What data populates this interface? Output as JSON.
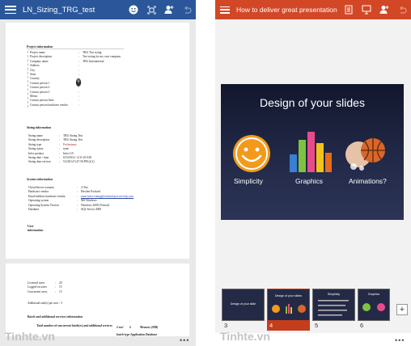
{
  "word": {
    "title": "LN_Sizing_TRG_test",
    "header_icons": [
      "smiley-icon",
      "scan-icon",
      "add-person-icon",
      "undo-icon"
    ],
    "project_info": {
      "section": "Project information",
      "rows": [
        {
          "k": "Project name",
          "v": "TRG Test sizing"
        },
        {
          "k": "Project description",
          "v": "Test sizing for my own company"
        },
        {
          "k": "Company name",
          "v": "TRG International"
        },
        {
          "k": "Address",
          "v": ""
        },
        {
          "k": "City",
          "v": ""
        },
        {
          "k": "State",
          "v": ""
        },
        {
          "k": "Country",
          "v": ""
        },
        {
          "k": "Contact person 1",
          "v": ""
        },
        {
          "k": "Contact person 2",
          "v": ""
        },
        {
          "k": "Contact person 3",
          "v": ""
        },
        {
          "k": "Memo",
          "v": ""
        },
        {
          "k": "Contact person Infor",
          "v": ""
        },
        {
          "k": "Contact person hardware vendor",
          "v": ""
        }
      ]
    },
    "sizing_info": {
      "section": "Sizing information",
      "rows": [
        {
          "k": "Sizing name",
          "v": "TRG Sizing Test"
        },
        {
          "k": "Sizing description",
          "v": "TRG Sizing Test"
        },
        {
          "k": "Sizing type",
          "v": "Preliminary"
        },
        {
          "k": "Sizing status",
          "v": "none"
        },
        {
          "k": "Infor product",
          "v": "Infor LN"
        },
        {
          "k": "Sizing date / time",
          "v": "6/10/2014 / 4:31:25 AM"
        },
        {
          "k": "Sizing data version",
          "v": "5/2/2014 5:47:56 PM (# 2)"
        }
      ]
    },
    "system_info": {
      "section": "System information",
      "rows": [
        {
          "k": "Client/Server scenario",
          "v": "2-Tier"
        },
        {
          "k": "Hardware vendor",
          "v": "Hewlett Packard"
        },
        {
          "k": "Email-address hardware vendor",
          "v": "team-infor-sizing@external.procurve.hp.com"
        },
        {
          "k": "Operating system",
          "v": "MS Windows"
        },
        {
          "k": "Operating System Version",
          "v": "Windows 2008 (Virtual)"
        },
        {
          "k": "Database",
          "v": "SQL Server 2008"
        }
      ]
    },
    "user_info": {
      "section_line1": "User",
      "section_line2": "information"
    },
    "page2": {
      "rows": [
        {
          "k": "Licensed users",
          "v": "20"
        },
        {
          "k": "Logged-on users",
          "v": "15"
        },
        {
          "k": "Concurrent users",
          "v": "15"
        }
      ],
      "additional_tasks": "Additional task(s) per user :  5",
      "batch_section": "Batch and additional services information",
      "table_header_1": "Total number of concurrent batch(es) and additional services",
      "table_header_2": "# exe/",
      "table_header_3": "#",
      "table_header_4": "Memory (MB)",
      "table_header_5": "batch-type Application Database"
    },
    "watermark": "Tinhte.vn",
    "ellipsis": "•••"
  },
  "ppt": {
    "title": "How to deliver great presentation",
    "header_icons": [
      "notes-icon",
      "present-icon",
      "add-person-icon",
      "undo-icon"
    ],
    "slide": {
      "title": "Design of your slides",
      "captions": [
        "Simplicity",
        "Graphics",
        "Animations?"
      ]
    },
    "thumbnails": [
      {
        "num": "3",
        "title": "Design of your slide"
      },
      {
        "num": "4",
        "title": "Design of your slides",
        "active": true
      },
      {
        "num": "5",
        "title": "Simplicity"
      },
      {
        "num": "6",
        "title": "Graphics"
      }
    ],
    "add_label": "+",
    "watermark": "Tinhte.vn",
    "ellipsis": "•••"
  },
  "colors": {
    "word_bar": "#2b579a",
    "ppt_bar": "#d24726",
    "ppt_active": "#c43e1c"
  }
}
